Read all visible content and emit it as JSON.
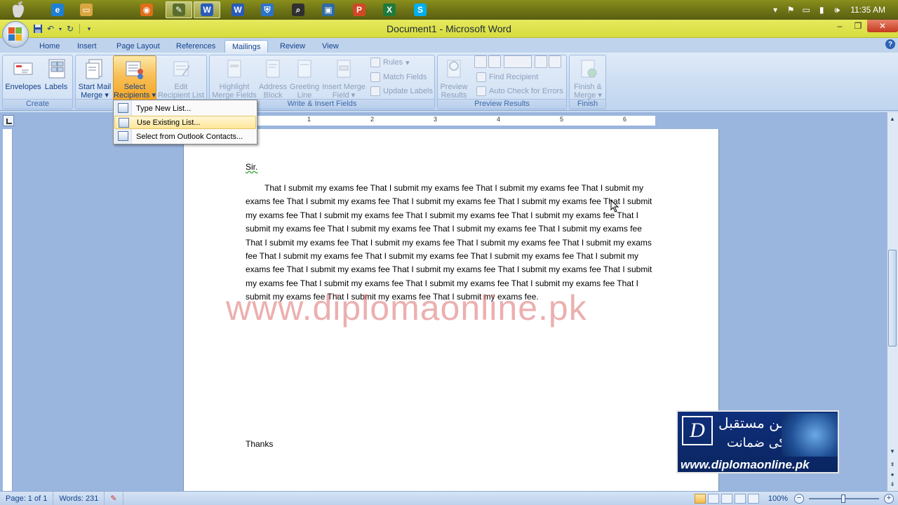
{
  "taskbar": {
    "apps": [
      {
        "name": "ie",
        "label": "e",
        "color": "#1e7fd4"
      },
      {
        "name": "explorer",
        "label": "▭",
        "color": "#d9a640"
      },
      {
        "name": "firefox",
        "label": "◉",
        "color": "#e06d19"
      },
      {
        "name": "paint",
        "label": "✎",
        "color": "#5a6e2c"
      },
      {
        "name": "word-active",
        "label": "W",
        "color": "#2a5bb8"
      },
      {
        "name": "word",
        "label": "W",
        "color": "#2a5bb8"
      },
      {
        "name": "security",
        "label": "⛨",
        "color": "#2d74c8"
      },
      {
        "name": "search-app",
        "label": "⌕",
        "color": "#303030"
      },
      {
        "name": "photo",
        "label": "▣",
        "color": "#2f6aa3"
      },
      {
        "name": "powerpoint",
        "label": "P",
        "color": "#d24726"
      },
      {
        "name": "excel",
        "label": "X",
        "color": "#1f7a3c"
      },
      {
        "name": "skype",
        "label": "S",
        "color": "#00aff0"
      }
    ],
    "clock": "11:35 AM"
  },
  "window": {
    "title": "Document1 - Microsoft Word"
  },
  "ribbon": {
    "tabs": [
      "Home",
      "Insert",
      "Page Layout",
      "References",
      "Mailings",
      "Review",
      "View"
    ],
    "active_tab": "Mailings",
    "groups": {
      "create": {
        "label": "Create",
        "envelopes": "Envelopes",
        "labels": "Labels"
      },
      "start_mail_merge": {
        "label": "Start Mail Merge",
        "start_line1": "Start Mail",
        "start_line2": "Merge",
        "select_line1": "Select",
        "select_line2": "Recipients",
        "edit_line1": "Edit",
        "edit_line2": "Recipient List"
      },
      "write_insert": {
        "label": "Write & Insert Fields",
        "highlight_line1": "Highlight",
        "highlight_line2": "Merge Fields",
        "address_line1": "Address",
        "address_line2": "Block",
        "greeting_line1": "Greeting",
        "greeting_line2": "Line",
        "insert_line1": "Insert Merge",
        "insert_line2": "Field",
        "rules": "Rules",
        "match_fields": "Match Fields",
        "update_labels": "Update Labels"
      },
      "preview": {
        "label": "Preview Results",
        "preview_line1": "Preview",
        "preview_line2": "Results",
        "find_recipient": "Find Recipient",
        "auto_check": "Auto Check for Errors"
      },
      "finish": {
        "label": "Finish",
        "finish_line1": "Finish &",
        "finish_line2": "Merge"
      }
    }
  },
  "dropdown": {
    "items": [
      {
        "label": "Type New List..."
      },
      {
        "label": "Use Existing List..."
      },
      {
        "label": "Select from Outlook Contacts..."
      }
    ],
    "hovered_index": 1
  },
  "ruler": {
    "numbers": [
      "1",
      "2",
      "3",
      "4",
      "5",
      "6"
    ]
  },
  "document": {
    "salutation": "Sir.",
    "body": "That I submit my exams fee That I submit my exams fee That I submit my exams fee That I submit my exams fee That I submit my exams fee That I submit my exams fee That I submit my exams fee That I submit my exams fee That I submit my exams fee That I submit my exams fee That I submit my exams fee That I submit my exams fee That I submit my exams fee That I submit my exams fee That I submit my exams fee That I submit my exams fee That I submit my exams fee That I submit my exams fee That I submit my exams fee That I submit my exams fee That I submit my exams fee That I submit my exams fee That I submit my exams fee That I submit my exams fee That I submit my exams fee That I submit my exams fee That I submit my exams fee That I submit my exams fee That I submit my exams fee That I submit my exams fee That I submit my exams fee That I submit my exams fee That I submit my exams fee.",
    "closing": "Thanks",
    "watermark": "www.diplomaonline.pk"
  },
  "promo": {
    "letter": "D",
    "urdu_line1": "روشن مستقبل",
    "urdu_line2": "کی ضمانت",
    "url": "www.diplomaonline.pk"
  },
  "statusbar": {
    "page": "Page: 1 of 1",
    "words": "Words: 231",
    "zoom": "100%"
  },
  "colors": {
    "taskbar": "#6d7316",
    "titlebar": "#d7dc3e",
    "ribbon": "#c7daf1",
    "accent_highlight": "#f7bf57"
  }
}
